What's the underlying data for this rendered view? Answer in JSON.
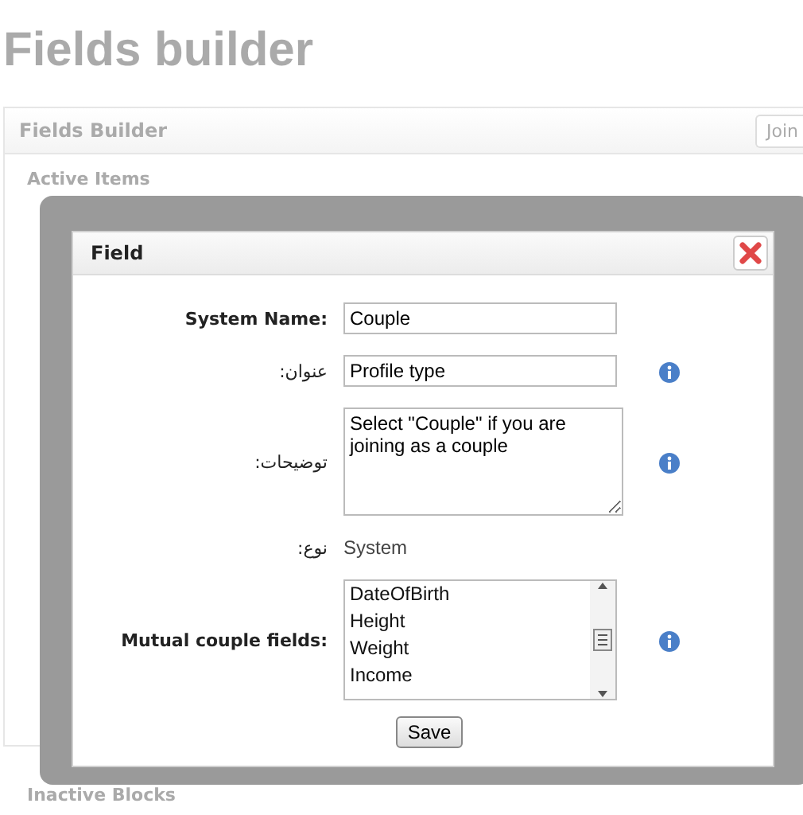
{
  "page_title": "Fields builder",
  "panel": {
    "title": "Fields Builder",
    "button": "Join"
  },
  "sections": [
    "Active Items",
    "Inactive Blocks"
  ],
  "dialog": {
    "title": "Field",
    "rows": [
      {
        "kind": "text",
        "label": "System Name:",
        "bold": true,
        "value": "Couple",
        "info": false
      },
      {
        "kind": "text",
        "label": "عنوان:",
        "bold": false,
        "value": "Profile type",
        "info": true
      },
      {
        "kind": "textarea",
        "label": "توضیحات:",
        "bold": false,
        "value": "Select \"Couple\" if you are joining as a couple",
        "info": true
      },
      {
        "kind": "static",
        "label": "نوع:",
        "bold": false,
        "value": "System",
        "info": false
      },
      {
        "kind": "list",
        "label": "Mutual couple fields:",
        "bold": true,
        "options": [
          "DateOfBirth",
          "Height",
          "Weight",
          "Income"
        ],
        "info": true
      }
    ],
    "save": "Save"
  }
}
